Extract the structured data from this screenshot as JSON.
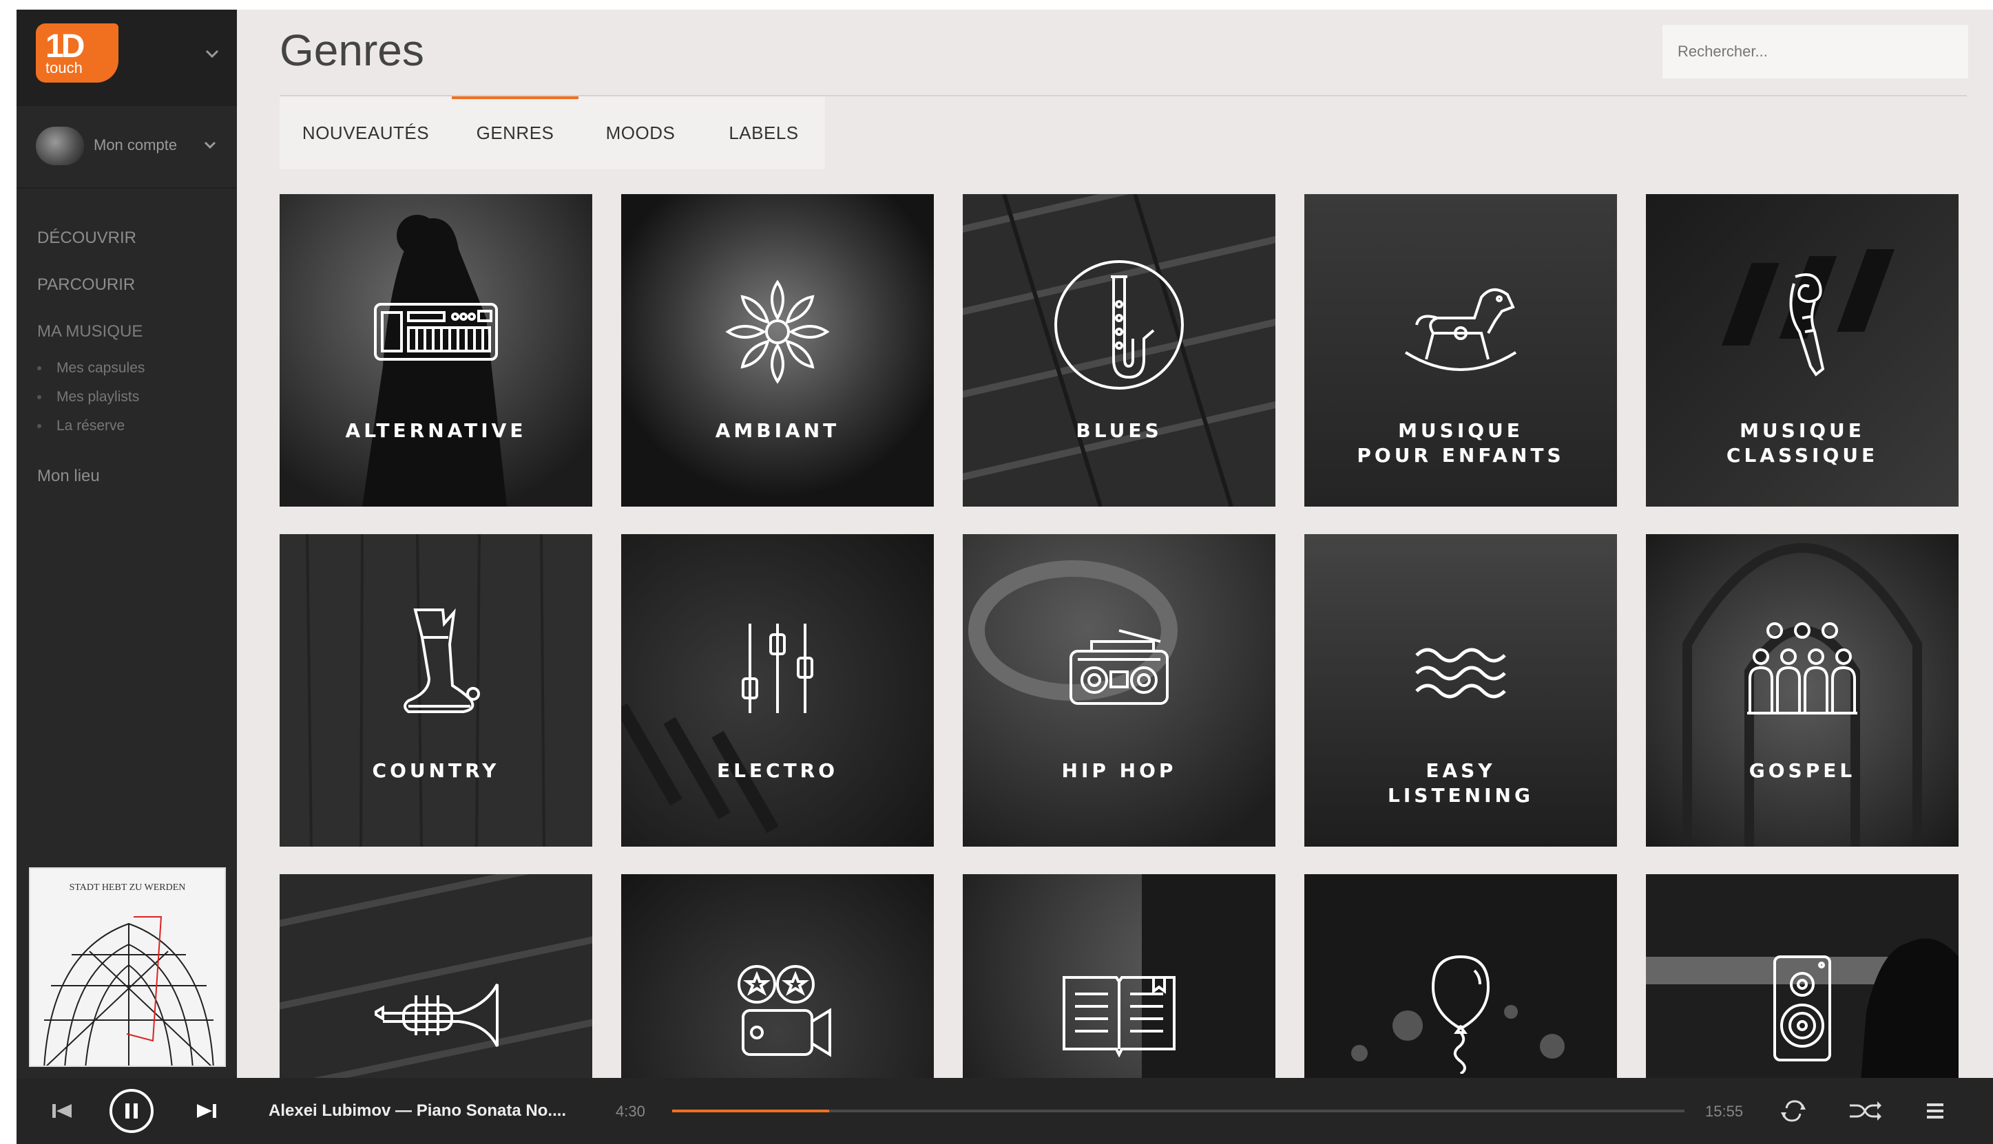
{
  "brand": {
    "big": "1D",
    "small": "touch"
  },
  "account": {
    "label": "Mon compte"
  },
  "nav": {
    "items": [
      "DÉCOUVRIR",
      "PARCOURIR",
      "MA MUSIQUE"
    ],
    "sub_items": [
      "Mes capsules",
      "Mes playlists",
      "La réserve"
    ],
    "mon_lieu": "Mon lieu"
  },
  "cover": {
    "title": "STADT HEBT ZU WERDEN"
  },
  "header": {
    "title": "Genres",
    "search_placeholder": "Rechercher..."
  },
  "tabs": [
    {
      "label": "NOUVEAUTÉS",
      "active": false
    },
    {
      "label": "GENRES",
      "active": true
    },
    {
      "label": "MOODS",
      "active": false
    },
    {
      "label": "LABELS",
      "active": false
    }
  ],
  "genres": [
    {
      "l1": "ALTERNATIVE",
      "l2": "",
      "icon": "keyboard-icon"
    },
    {
      "l1": "AMBIANT",
      "l2": "",
      "icon": "lotus-icon"
    },
    {
      "l1": "BLUES",
      "l2": "",
      "icon": "saxophone-icon"
    },
    {
      "l1": "MUSIQUE",
      "l2": "POUR ENFANTS",
      "icon": "rocking-horse-icon"
    },
    {
      "l1": "MUSIQUE",
      "l2": "CLASSIQUE",
      "icon": "violin-scroll-icon"
    },
    {
      "l1": "COUNTRY",
      "l2": "",
      "icon": "cowboy-boot-icon"
    },
    {
      "l1": "ELECTRO",
      "l2": "",
      "icon": "mixer-sliders-icon"
    },
    {
      "l1": "HIP HOP",
      "l2": "",
      "icon": "boombox-icon"
    },
    {
      "l1": "EASY",
      "l2": "LISTENING",
      "icon": "waves-icon"
    },
    {
      "l1": "GOSPEL",
      "l2": "",
      "icon": "choir-icon"
    },
    {
      "l1": "",
      "l2": "",
      "icon": "trumpet-icon"
    },
    {
      "l1": "",
      "l2": "",
      "icon": "movie-camera-icon"
    },
    {
      "l1": "",
      "l2": "",
      "icon": "open-book-icon"
    },
    {
      "l1": "",
      "l2": "",
      "icon": "balloon-icon"
    },
    {
      "l1": "",
      "l2": "",
      "icon": "speaker-icon"
    }
  ],
  "player": {
    "track": "Alexei Lubimov — Piano Sonata No....",
    "elapsed": "4:30",
    "total": "15:55",
    "progress": 0.155,
    "accent": "#f07020"
  }
}
